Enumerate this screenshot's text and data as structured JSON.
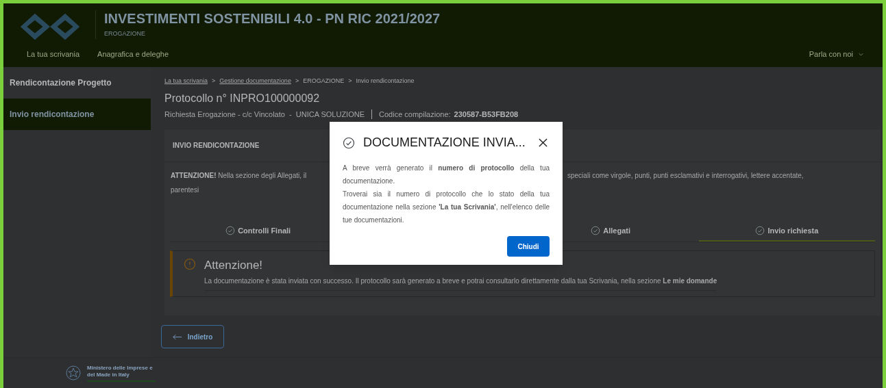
{
  "header": {
    "title": "INVESTIMENTI SOSTENIBILI 4.0 - PN RIC 2021/2027",
    "subtitle": "EROGAZIONE",
    "nav": [
      {
        "label": "La tua scrivania"
      },
      {
        "label": "Anagrafica e deleghe"
      }
    ],
    "contact": "Parla con noi"
  },
  "sidebar": {
    "items": [
      {
        "label": "Rendicontazione Progetto",
        "selected": false
      },
      {
        "label": "Invio rendicontazione",
        "selected": true
      }
    ]
  },
  "breadcrumb": {
    "separator": ">",
    "items": [
      {
        "label": "La tua scrivania",
        "kind": "link"
      },
      {
        "label": "Gestione documentazione",
        "kind": "link"
      },
      {
        "label": "EROGAZIONE",
        "kind": "text"
      },
      {
        "label": "Invio rendicontazione",
        "kind": "text"
      }
    ]
  },
  "page_title": "Protocollo n° INPRO100000092",
  "subtitle": {
    "request": "Richiesta Erogazione - c/c Vincolato  -  UNICA SOLUZIONE",
    "code_label": "Codice compilazione:",
    "code": "230587-B53FB208"
  },
  "card": {
    "title": "INVIO RENDICONTAZIONE",
    "notice": {
      "lead": "ATTENZIONE!",
      "text_start": "Nella sezione degli Allegati, il",
      "text_end": "speciali come virgole, punti, punti esclamativi e interrogativi, lettere accentate,",
      "text_last": "parentesi"
    },
    "steps": [
      {
        "label": "Controlli Finali",
        "selected": false
      },
      {
        "label": "Allegati",
        "selected": false
      },
      {
        "label": "Invio richiesta",
        "selected": true
      }
    ],
    "alert": {
      "title": "Attenzione!",
      "text": "La documentazione è stata inviata con successo. Il protocollo sarà generato a breve e potrai consultarlo direttamente dalla tua Scrivania, nella sezione **Le mie domande**"
    }
  },
  "back_button": "Indietro",
  "footer": {
    "ministry": "Ministero delle Imprese e del Made in Italy"
  },
  "modal": {
    "title": "DOCUMENTAZIONE INVIA...",
    "paragraphs": [
      "A breve verrà generato il **numero di protocollo** della tua documentazione.",
      "Troverai sia il numero di protocollo che lo stato della tua documentazione nella sezione **'La tua Scrivania'**, nell'elenco delle tue documentazioni."
    ],
    "button": "Chiudi"
  }
}
